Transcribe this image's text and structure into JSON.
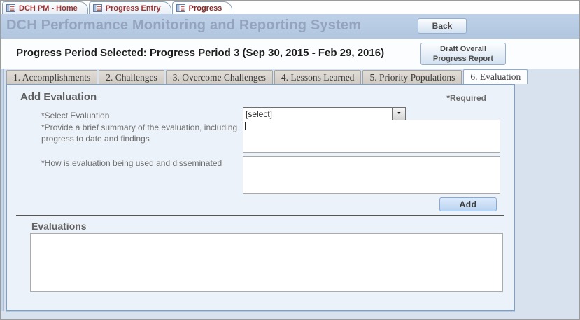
{
  "window_tabs": [
    {
      "label": "DCH PM - Home",
      "active": false
    },
    {
      "label": "Progress Entry",
      "active": false
    },
    {
      "label": "Progress",
      "active": true
    }
  ],
  "banner": {
    "title": "DCH Performance Monitoring and Reporting System",
    "back_button_label": "Back"
  },
  "period_bar": {
    "selected_text": "Progress Period Selected: Progress Period 3 (Sep 30, 2015 - Feb 29, 2016)",
    "draft_report_button_label": "Draft Overall Progress Report"
  },
  "section_tabs": [
    {
      "label": "1. Accomplishments",
      "active": false
    },
    {
      "label": "2. Challenges",
      "active": false
    },
    {
      "label": "3. Overcome Challenges",
      "active": false
    },
    {
      "label": "4. Lessons Learned",
      "active": false
    },
    {
      "label": "5. Priority Populations",
      "active": false
    },
    {
      "label": "6. Evaluation",
      "active": true
    }
  ],
  "add_evaluation": {
    "heading": "Add Evaluation",
    "required_note": "*Required",
    "fields": {
      "select_evaluation": {
        "label": "*Select Evaluation",
        "value": "[select]"
      },
      "summary": {
        "label": "*Provide a brief summary of the evaluation, including progress to date and findings",
        "value": ""
      },
      "dissemination": {
        "label": "*How is evaluation being used and disseminated",
        "value": ""
      }
    },
    "add_button_label": "Add"
  },
  "evaluations": {
    "heading": "Evaluations",
    "items": []
  },
  "icons": {
    "dropdown_arrow": "▼"
  },
  "colors": {
    "banner_bg": "#b8cbe2",
    "banner_title_text": "#94a4bf",
    "page_bg_lower": "#d8e2ef",
    "panel_bg": "#ecf2f9",
    "panel_border": "#7d9fc9",
    "object_tab_text": "#9c3232",
    "inactive_tab_bg": "#d5d1c9",
    "button_border": "#96afcc"
  }
}
